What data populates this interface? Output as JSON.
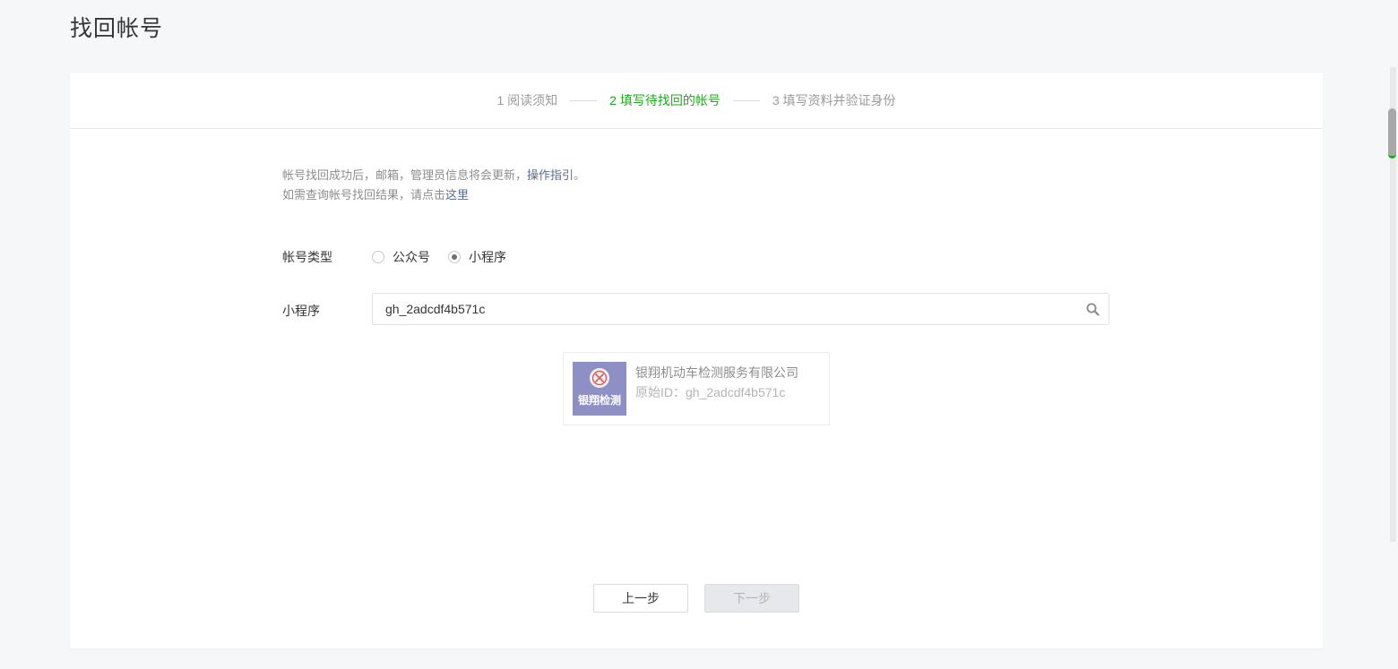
{
  "page": {
    "title": "找回帐号"
  },
  "steps": [
    {
      "label": "1 阅读须知",
      "active": false
    },
    {
      "label": "2 填写待找回的帐号",
      "active": true
    },
    {
      "label": "3 填写资料并验证身份",
      "active": false
    }
  ],
  "notice": {
    "line1_prefix": "帐号找回成功后，邮箱，管理员信息将会更新，",
    "line1_link": "操作指引",
    "line1_suffix": "。",
    "line2_prefix": "如需查询帐号找回结果，请点击",
    "line2_link": "这里"
  },
  "form": {
    "account_type_label": "帐号类型",
    "account_type_options": [
      {
        "label": "公众号",
        "checked": false
      },
      {
        "label": "小程序",
        "checked": true
      }
    ],
    "miniprogram_label": "小程序",
    "search_value": "gh_2adcdf4b571c",
    "search_icon": "search-icon"
  },
  "result": {
    "avatar_text": "银翔检测",
    "name": "银翔机动车检测服务有限公司",
    "id_text": "原始ID：gh_2adcdf4b571c"
  },
  "buttons": {
    "prev": "上一步",
    "next": "下一步"
  },
  "colors": {
    "active_step": "#1aad19",
    "link": "#576b95",
    "avatar_bg": "#8e8fc4"
  }
}
